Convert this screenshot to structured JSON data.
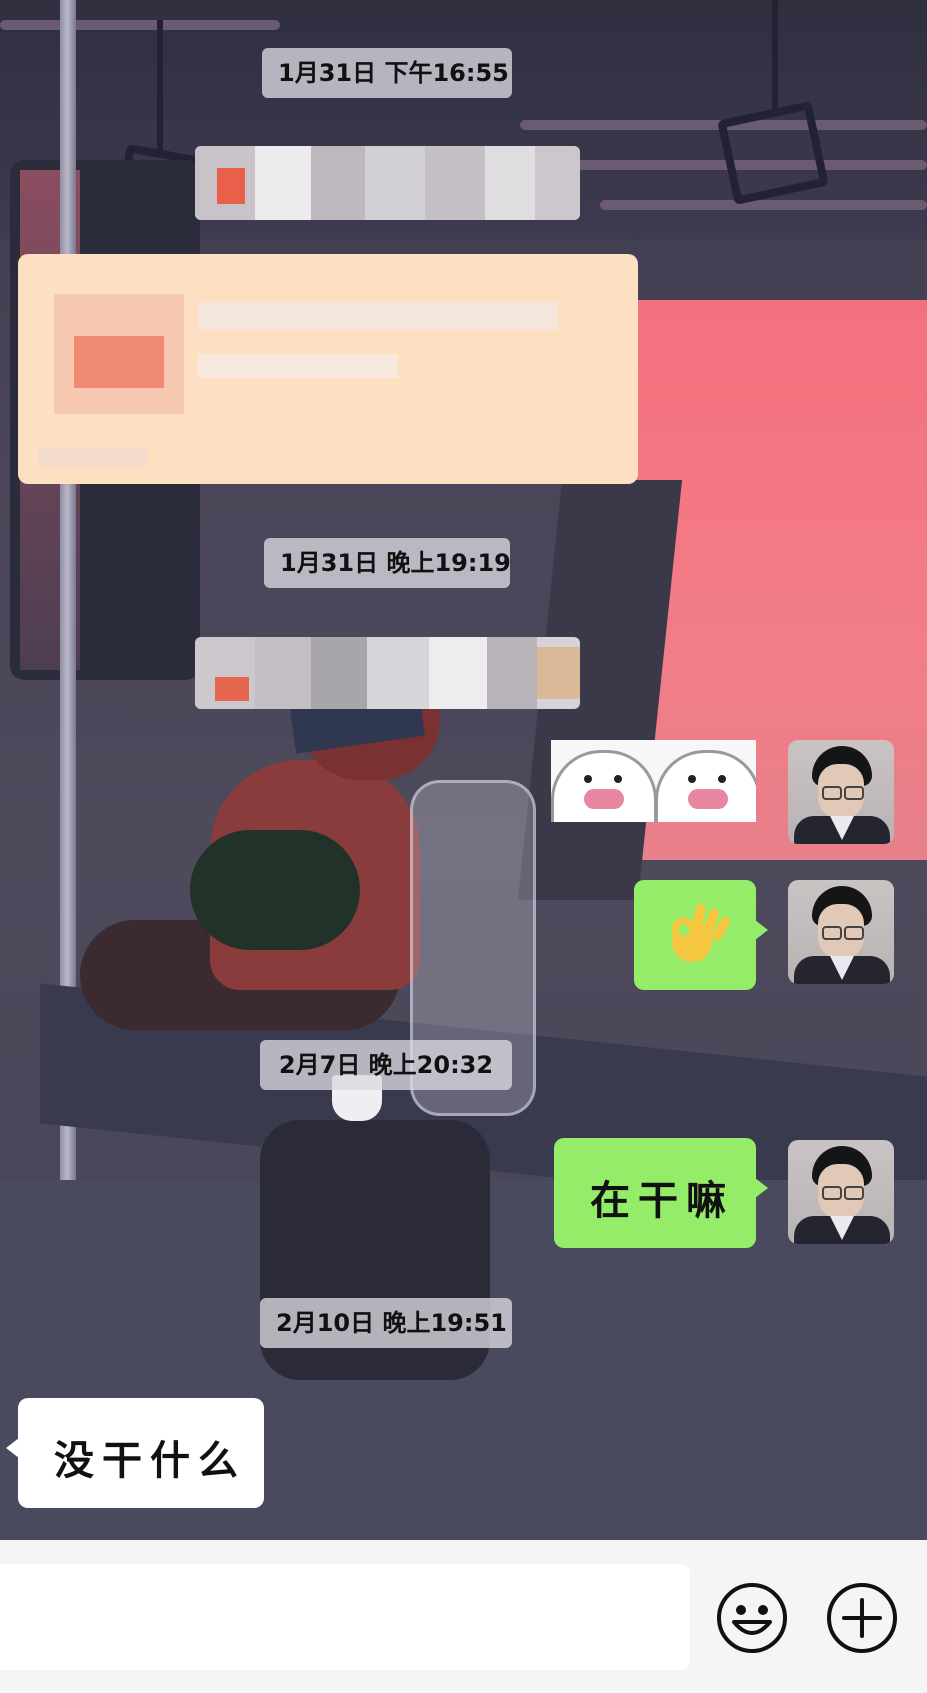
{
  "timestamps": {
    "t1": "1月31日 下午16:55",
    "t2": "1月31日 晚上19:19",
    "t3": "2月7日 晚上20:32",
    "t4": "2月10日 晚上19:51"
  },
  "messages": {
    "sent_sticker": "ok-hand-emoji",
    "sent_text": "在干嘛",
    "received_text": "没干什么"
  },
  "input": {
    "value": "",
    "placeholder": ""
  },
  "colors": {
    "sent_bubble": "#95ec69",
    "received_bubble": "#ffffff",
    "timestamp_pill": "#dcd8e2",
    "input_bar": "#f5f5f5"
  },
  "icons": {
    "emoji": "smiley-face-icon",
    "more": "plus-circle-icon"
  }
}
